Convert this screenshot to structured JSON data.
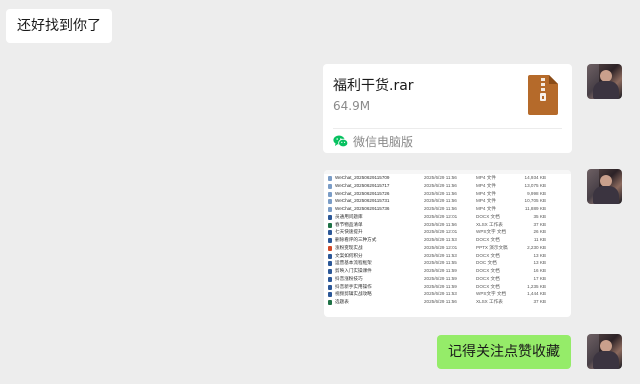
{
  "messages": {
    "incoming_text": "还好找到你了",
    "file": {
      "name": "福利干货.rar",
      "size": "64.9M",
      "source": "微信电脑版",
      "icon": "archive-file-icon"
    },
    "screenshot_rows": [
      {
        "name": "WeChat_20250629115709",
        "date": "2025/6/29 11:56",
        "type": "MP4 文件",
        "size": "14,934 KB",
        "icon_color": "#7a9cc6"
      },
      {
        "name": "WeChat_20250629115717",
        "date": "2025/6/29 11:56",
        "type": "MP4 文件",
        "size": "13,075 KB",
        "icon_color": "#7a9cc6"
      },
      {
        "name": "WeChat_20250629115726",
        "date": "2025/6/29 11:56",
        "type": "MP4 文件",
        "size": "9,998 KB",
        "icon_color": "#7a9cc6"
      },
      {
        "name": "WeChat_20250629115731",
        "date": "2025/6/29 11:56",
        "type": "MP4 文件",
        "size": "10,705 KB",
        "icon_color": "#7a9cc6"
      },
      {
        "name": "WeChat_20250629115736",
        "date": "2025/6/29 11:56",
        "type": "MP4 文件",
        "size": "11,889 KB",
        "icon_color": "#7a9cc6"
      },
      {
        "name": "员通用问题库",
        "date": "2025/6/29 12:01",
        "type": "DOCX 文档",
        "size": "35 KB",
        "icon_color": "#2b5797"
      },
      {
        "name": "春节物品清单",
        "date": "2025/6/29 11:56",
        "type": "XLSX 工作表",
        "size": "37 KB",
        "icon_color": "#1e7145"
      },
      {
        "name": "七天快速提升",
        "date": "2025/6/29 12:01",
        "type": "WPS文字 文档",
        "size": "26 KB",
        "icon_color": "#2b5797"
      },
      {
        "name": "删除看评的三种方式",
        "date": "2025/6/29 11:53",
        "type": "DOCX 文档",
        "size": "11 KB",
        "icon_color": "#2b5797"
      },
      {
        "name": "涨粉变现实战",
        "date": "2025/6/29 12:01",
        "type": "PPTX 演示文稿",
        "size": "2,230 KB",
        "icon_color": "#d24726"
      },
      {
        "name": "文案如何积分",
        "date": "2025/6/29 11:53",
        "type": "DOCX 文档",
        "size": "13 KB",
        "icon_color": "#2b5797"
      },
      {
        "name": "运营基本流程框架",
        "date": "2025/6/29 11:55",
        "type": "DOC 文档",
        "size": "13 KB",
        "icon_color": "#2b5797"
      },
      {
        "name": "剪映入门实操课件",
        "date": "2025/6/29 11:59",
        "type": "DOCX 文档",
        "size": "16 KB",
        "icon_color": "#2b5797"
      },
      {
        "name": "抖音涨粉技巧",
        "date": "2025/6/29 11:59",
        "type": "DOCX 文档",
        "size": "17 KB",
        "icon_color": "#2b5797"
      },
      {
        "name": "抖音新手实用操作",
        "date": "2025/6/29 11:59",
        "type": "DOCX 文档",
        "size": "1,235 KB",
        "icon_color": "#2b5797"
      },
      {
        "name": "视频剪辑实战攻略",
        "date": "2025/6/29 11:53",
        "type": "WPS文字 文档",
        "size": "1,444 KB",
        "icon_color": "#2b5797"
      },
      {
        "name": "选题表",
        "date": "2025/6/29 11:56",
        "type": "XLSX 工作表",
        "size": "37 KB",
        "icon_color": "#1e7145"
      }
    ],
    "outgoing_text": "记得关注点赞收藏"
  },
  "colors": {
    "background": "#ededed",
    "incoming_bubble": "#ffffff",
    "outgoing_bubble": "#95ec69",
    "file_icon": "#b56a2a",
    "wechat_green": "#07c160"
  }
}
